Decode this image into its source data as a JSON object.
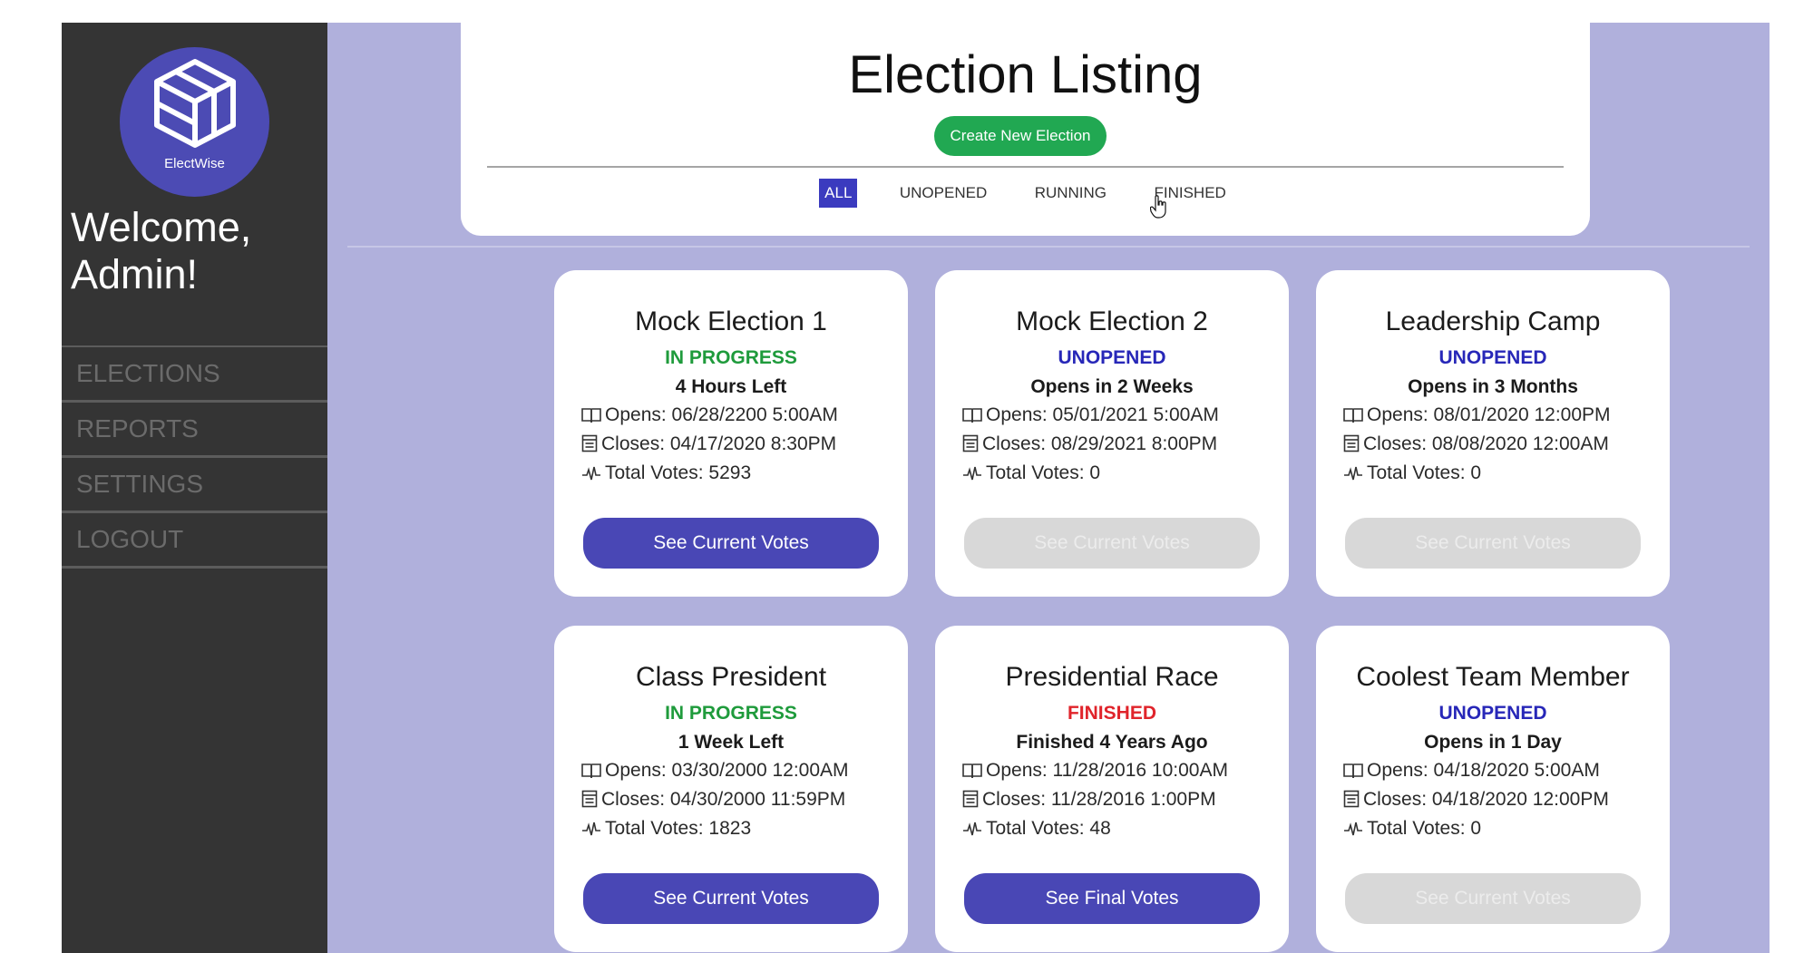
{
  "sidebar": {
    "logo_text": "ElectWise",
    "welcome_line1": "Welcome,",
    "welcome_line2": "Admin!",
    "nav": [
      "ELECTIONS",
      "REPORTS",
      "SETTINGS",
      "LOGOUT"
    ]
  },
  "header": {
    "title": "Election Listing",
    "create_button": "Create New Election",
    "tabs": [
      "ALL",
      "UNOPENED",
      "RUNNING",
      "FINISHED"
    ],
    "active_tab": "ALL"
  },
  "cards": [
    {
      "title": "Mock Election 1",
      "status": "IN PROGRESS",
      "status_color": "#1f9b3c",
      "time": "4 Hours Left",
      "opens": "Opens: 06/28/2200 5:00AM",
      "closes": "Closes: 04/17/2020 8:30PM",
      "votes": "Total Votes: 5293",
      "button": "See Current Votes",
      "button_enabled": true
    },
    {
      "title": "Mock Election 2",
      "status": "UNOPENED",
      "status_color": "#2727b8",
      "time": "Opens in 2 Weeks",
      "opens": "Opens: 05/01/2021 5:00AM",
      "closes": "Closes: 08/29/2021 8:00PM",
      "votes": "Total Votes: 0",
      "button": "See Current Votes",
      "button_enabled": false
    },
    {
      "title": "Leadership Camp",
      "status": "UNOPENED",
      "status_color": "#2727b8",
      "time": "Opens in 3 Months",
      "opens": "Opens: 08/01/2020 12:00PM",
      "closes": "Closes: 08/08/2020 12:00AM",
      "votes": "Total Votes: 0",
      "button": "See Current Votes",
      "button_enabled": false
    },
    {
      "title": "Class President",
      "status": "IN PROGRESS",
      "status_color": "#1f9b3c",
      "time": "1 Week Left",
      "opens": "Opens: 03/30/2000 12:00AM",
      "closes": "Closes: 04/30/2000 11:59PM",
      "votes": "Total Votes: 1823",
      "button": "See Current Votes",
      "button_enabled": true
    },
    {
      "title": "Presidential Race",
      "status": "FINISHED",
      "status_color": "#e0242b",
      "time": "Finished 4 Years Ago",
      "opens": "Opens: 11/28/2016 10:00AM",
      "closes": "Closes: 11/28/2016 1:00PM",
      "votes": "Total Votes: 48",
      "button": "See Final Votes",
      "button_enabled": true
    },
    {
      "title": "Coolest Team Member",
      "status": "UNOPENED",
      "status_color": "#2727b8",
      "time": "Opens in 1 Day",
      "opens": "Opens: 04/18/2020 5:00AM",
      "closes": "Closes: 04/18/2020 12:00PM",
      "votes": "Total Votes: 0",
      "button": "See Current Votes",
      "button_enabled": false
    }
  ],
  "icons": {
    "opens": "book-open-icon",
    "closes": "calendar-icon",
    "votes": "pulse-icon"
  },
  "colors": {
    "sidebar": "#343434",
    "main_bg": "#b0b0dc",
    "accent": "#4947b5",
    "create": "#21a852"
  }
}
